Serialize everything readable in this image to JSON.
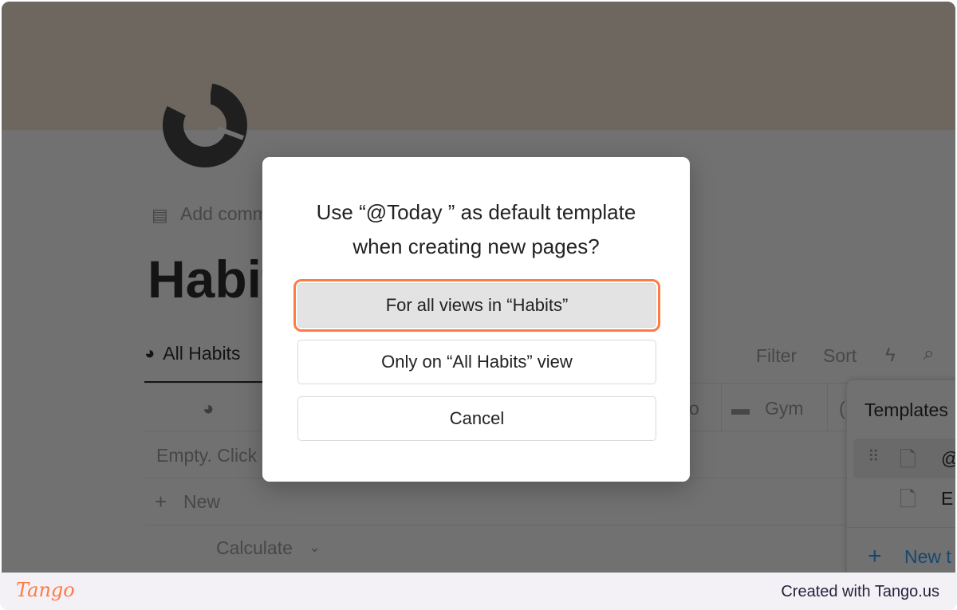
{
  "page": {
    "add_comment": "Add comment",
    "title": "Habits",
    "view_tab": "All Habits",
    "empty_text": "Empty. Click",
    "new_label": "New",
    "calculate_label": "Calculate",
    "filter": "Filter",
    "sort": "Sort",
    "columns": [
      "o",
      "Gym",
      "("
    ]
  },
  "templates_panel": {
    "title": "Templates",
    "items": [
      "@",
      "E"
    ],
    "new_label": "New t"
  },
  "modal": {
    "title_line1": "Use “@Today ” as default template",
    "title_line2": "when creating new pages?",
    "buttons": [
      "For all views in “Habits”",
      "Only on “All Habits” view",
      "Cancel"
    ]
  },
  "footer": {
    "logo": "Tango",
    "credit": "Created with Tango.us"
  },
  "colors": {
    "highlight": "#ff7a45",
    "accent": "#2383e2",
    "footer_bg": "#f3f1f6"
  }
}
